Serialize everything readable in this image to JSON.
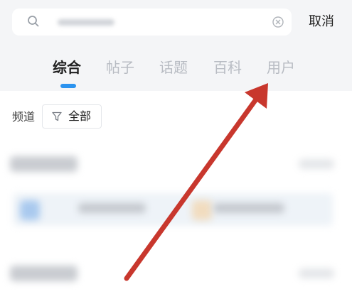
{
  "search": {
    "placeholder": "",
    "icon": "search-icon",
    "clear_icon": "clear-icon",
    "cancel_label": "取消"
  },
  "tabs": [
    {
      "label": "综合",
      "active": true
    },
    {
      "label": "帖子",
      "active": false
    },
    {
      "label": "话题",
      "active": false
    },
    {
      "label": "百科",
      "active": false
    },
    {
      "label": "用户",
      "active": false
    }
  ],
  "filter": {
    "channel_label": "频道",
    "chip_label": "全部",
    "chip_icon": "funnel-icon"
  },
  "colors": {
    "accent": "#2b93ef",
    "tab_active": "#1f1f1f",
    "tab_inactive": "#b8bcc3",
    "header_bg": "#f4f5f7",
    "annotation_arrow": "#c8372d"
  },
  "annotation": {
    "type": "arrow",
    "points_to": "tab-users"
  }
}
